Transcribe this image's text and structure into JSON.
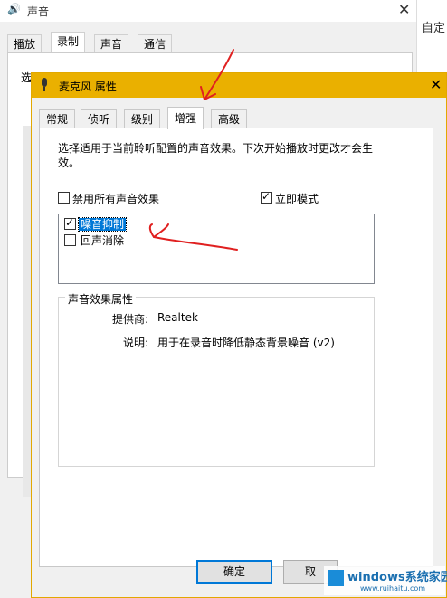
{
  "sound_window": {
    "title": "声音",
    "tabs": [
      {
        "label": "播放"
      },
      {
        "label": "录制"
      },
      {
        "label": "声音"
      },
      {
        "label": "通信"
      }
    ],
    "active_tab": "录制",
    "panel_label_fragment": "选",
    "right_partial_text": "自定"
  },
  "dialog": {
    "title": "麦克风 属性",
    "tabs": [
      {
        "label": "常规"
      },
      {
        "label": "侦听"
      },
      {
        "label": "级别"
      },
      {
        "label": "增强"
      },
      {
        "label": "高级"
      }
    ],
    "active_tab": "增强",
    "description": "选择适用于当前聆听配置的声音效果。下次开始播放时更改才会生效。",
    "disable_all": {
      "label": "禁用所有声音效果",
      "checked": false
    },
    "immediate_mode": {
      "label": "立即模式",
      "checked": true
    },
    "effects": [
      {
        "label": "噪音抑制",
        "checked": true,
        "selected": true
      },
      {
        "label": "回声消除",
        "checked": false,
        "selected": false
      }
    ],
    "properties": {
      "group_title": "声音效果属性",
      "provider_label": "提供商:",
      "provider_value": "Realtek",
      "description_label": "说明:",
      "description_value": "用于在录音时降低静态背景噪音 (v2)"
    },
    "buttons": {
      "ok": "确定",
      "cancel": "取"
    }
  },
  "watermark": {
    "brand": "windows系统家园",
    "url": "www.ruihaitu.com"
  },
  "colors": {
    "dialog_titlebar": "#eab000",
    "selection": "#0078d7",
    "annotation": "#e02020"
  }
}
